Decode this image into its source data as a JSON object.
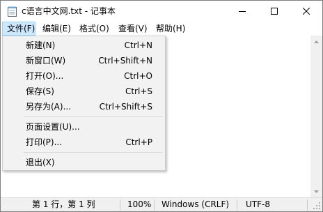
{
  "window": {
    "title": "c语言中文网.txt - 记事本"
  },
  "menubar": {
    "items": [
      {
        "label": "文件(F)",
        "active": true
      },
      {
        "label": "编辑(E)"
      },
      {
        "label": "格式(O)"
      },
      {
        "label": "查看(V)"
      },
      {
        "label": "帮助(H)"
      }
    ]
  },
  "file_menu": {
    "items": [
      {
        "label": "新建(N)",
        "shortcut": "Ctrl+N"
      },
      {
        "label": "新窗口(W)",
        "shortcut": "Ctrl+Shift+N"
      },
      {
        "label": "打开(O)...",
        "shortcut": "Ctrl+O"
      },
      {
        "label": "保存(S)",
        "shortcut": "Ctrl+S"
      },
      {
        "label": "另存为(A)...",
        "shortcut": "Ctrl+Shift+S"
      },
      {
        "label": "页面设置(U)...",
        "shortcut": ""
      },
      {
        "label": "打印(P)...",
        "shortcut": "Ctrl+P"
      },
      {
        "label": "退出(X)",
        "shortcut": ""
      }
    ]
  },
  "statusbar": {
    "position": "第 1 行，第 1 列",
    "zoom": "100%",
    "line_ending": "Windows (CRLF)",
    "encoding": "UTF-8"
  },
  "colors": {
    "menu_active_bg": "#cce8ff",
    "menu_active_border": "#99d1ff",
    "dropdown_bg": "#f2f2f2",
    "statusbar_bg": "#f0f0f0"
  },
  "icons": {
    "app": "notepad-icon",
    "minimize": "minimize-icon",
    "maximize": "maximize-icon",
    "close": "close-icon"
  }
}
